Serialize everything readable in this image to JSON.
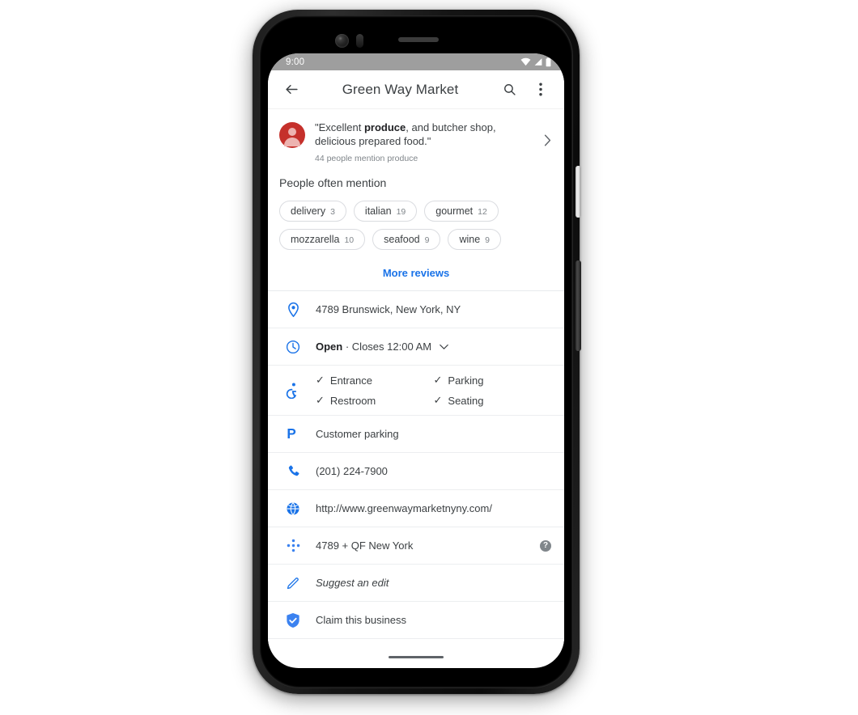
{
  "status_bar": {
    "time": "9:00",
    "icons": [
      "wifi-icon",
      "signal-icon",
      "battery-icon"
    ]
  },
  "app_bar": {
    "back_icon": "back-arrow-icon",
    "title": "Green Way Market",
    "search_icon": "search-icon",
    "overflow_icon": "more-vert-icon"
  },
  "review": {
    "avatar": "user-avatar",
    "quote_before": "\"Excellent ",
    "quote_bold": "produce",
    "quote_after": ", and butcher shop, delicious prepared food.\"",
    "subtitle": "44 people mention produce",
    "chevron": "chevron-right-icon"
  },
  "mentions": {
    "title": "People often mention",
    "chips": [
      {
        "label": "delivery",
        "count": "3"
      },
      {
        "label": "italian",
        "count": "19"
      },
      {
        "label": "gourmet",
        "count": "12"
      },
      {
        "label": "mozzarella",
        "count": "10"
      },
      {
        "label": "seafood",
        "count": "9"
      },
      {
        "label": "wine",
        "count": "9"
      }
    ],
    "more_reviews": "More reviews"
  },
  "info_rows": {
    "address": {
      "icon": "location-pin-icon",
      "label": "4789 Brunswick, New York, NY"
    },
    "hours": {
      "icon": "clock-icon",
      "status": "Open",
      "separator": " · ",
      "closes": "Closes 12:00 AM",
      "chevron": "chevron-down-icon"
    },
    "accessibility": {
      "icon": "wheelchair-icon",
      "items": [
        "Entrance",
        "Parking",
        "Restroom",
        "Seating"
      ],
      "tick": "✓"
    },
    "parking": {
      "icon": "parking-p-icon",
      "label": "Customer parking"
    },
    "phone": {
      "icon": "phone-icon",
      "label": "(201) 224-7900"
    },
    "website": {
      "icon": "globe-icon",
      "label": "http://www.greenwaymarketnyny.com/"
    },
    "pluscode": {
      "icon": "plus-code-icon",
      "label": "4789 + QF New York",
      "help_icon": "help-circle-icon",
      "help_glyph": "?"
    },
    "suggest_edit": {
      "icon": "pencil-icon",
      "label": "Suggest an edit"
    },
    "claim": {
      "icon": "shield-check-icon",
      "label": "Claim this business"
    }
  },
  "colors": {
    "accent_blue": "#1a73e8",
    "text_primary": "#3c4043",
    "text_secondary": "#80868b",
    "avatar_red": "#c5302b",
    "divider": "#eceef0",
    "status_bar": "#9e9e9e"
  }
}
